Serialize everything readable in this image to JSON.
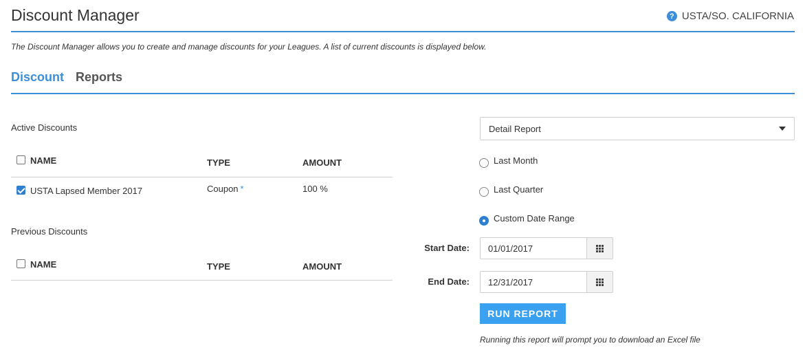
{
  "header": {
    "title": "Discount Manager",
    "organization": "USTA/SO. CALIFORNIA",
    "help_icon": "?"
  },
  "description": "The Discount Manager allows you to create and manage discounts for your Leagues. A list of current discounts is displayed below.",
  "tabs": [
    {
      "label": "Discount",
      "active": true
    },
    {
      "label": "Reports",
      "active": false
    }
  ],
  "active_discounts": {
    "label": "Active Discounts",
    "columns": [
      "NAME",
      "TYPE",
      "AMOUNT"
    ],
    "rows": [
      {
        "checked": true,
        "name": "USTA Lapsed Member 2017",
        "type": "Coupon",
        "type_marker": "*",
        "amount": "100 %"
      }
    ]
  },
  "previous_discounts": {
    "label": "Previous Discounts",
    "columns": [
      "NAME",
      "TYPE",
      "AMOUNT"
    ],
    "rows": []
  },
  "report": {
    "selected_report": "Detail Report",
    "options": [
      {
        "label": "Last Month",
        "selected": false
      },
      {
        "label": "Last Quarter",
        "selected": false
      },
      {
        "label": "Custom Date Range",
        "selected": true
      }
    ],
    "start_date_label": "Start Date:",
    "start_date": "01/01/2017",
    "end_date_label": "End Date:",
    "end_date": "12/31/2017",
    "run_button": "RUN REPORT",
    "note": "Running this report will prompt you to download an Excel file"
  },
  "colors": {
    "accent": "#3d8ed9",
    "button": "#3aa0f0"
  }
}
